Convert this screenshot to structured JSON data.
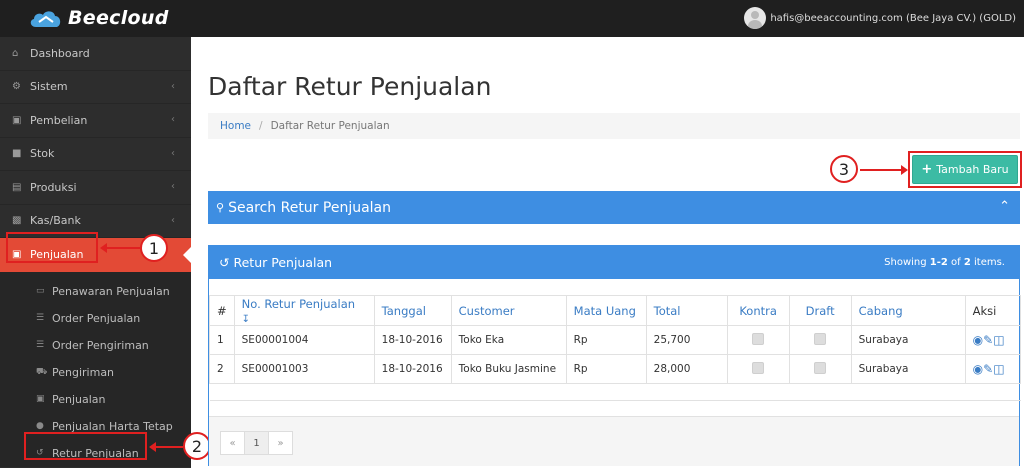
{
  "app": {
    "name": "Beecloud"
  },
  "user": {
    "label": "hafis@beeaccounting.com (Bee Jaya CV.) (GOLD)"
  },
  "sidebar": {
    "items": [
      {
        "label": "Dashboard",
        "icon": "home-icon"
      },
      {
        "label": "Sistem",
        "icon": "cogs-icon"
      },
      {
        "label": "Pembelian",
        "icon": "cart-icon"
      },
      {
        "label": "Stok",
        "icon": "box-icon"
      },
      {
        "label": "Produksi",
        "icon": "factory-icon"
      },
      {
        "label": "Kas/Bank",
        "icon": "money-icon"
      },
      {
        "label": "Penjualan",
        "icon": "cart-icon"
      }
    ],
    "sub_items": [
      {
        "label": "Penawaran Penjualan",
        "icon": "card-icon"
      },
      {
        "label": "Order Penjualan",
        "icon": "list-icon"
      },
      {
        "label": "Order Pengiriman",
        "icon": "list-icon"
      },
      {
        "label": "Pengiriman",
        "icon": "truck-icon"
      },
      {
        "label": "Penjualan",
        "icon": "cart-icon"
      },
      {
        "label": "Penjualan Harta Tetap",
        "icon": "car-icon"
      },
      {
        "label": "Retur Penjualan",
        "icon": "undo-icon"
      }
    ]
  },
  "callouts": {
    "one": "1",
    "two": "2",
    "three": "3"
  },
  "main": {
    "title": "Daftar Retur Penjualan",
    "breadcrumb": {
      "home": "Home",
      "separator": "/",
      "current": "Daftar Retur Penjualan"
    },
    "add_button": "Tambah Baru",
    "search_panel_title": "Search Retur Penjualan",
    "list_panel_title": "Retur Penjualan",
    "showing": {
      "prefix": "Showing ",
      "range": "1-2",
      "of": " of ",
      "total": "2",
      "suffix": " items."
    },
    "table": {
      "headers": [
        "#",
        "No. Retur Penjualan",
        "Tanggal",
        "Customer",
        "Mata Uang",
        "Total",
        "Kontra",
        "Draft",
        "Cabang",
        "Aksi"
      ],
      "rows": [
        {
          "no": "1",
          "number": "SE00001004",
          "date": "18-10-2016",
          "customer": "Toko Eka",
          "currency": "Rp",
          "total": "25,700",
          "branch": "Surabaya"
        },
        {
          "no": "2",
          "number": "SE00001003",
          "date": "18-10-2016",
          "customer": "Toko Buku Jasmine",
          "currency": "Rp",
          "total": "28,000",
          "branch": "Surabaya"
        }
      ]
    },
    "pagination": {
      "prev": "«",
      "page": "1",
      "next": "»"
    }
  },
  "colors": {
    "topbar": "#1f1f1f",
    "sidebar": "#2d2d2d",
    "active": "#e34a36",
    "panel": "#3e8ee2",
    "add_button": "#3cbba4",
    "callout": "#e02020"
  }
}
